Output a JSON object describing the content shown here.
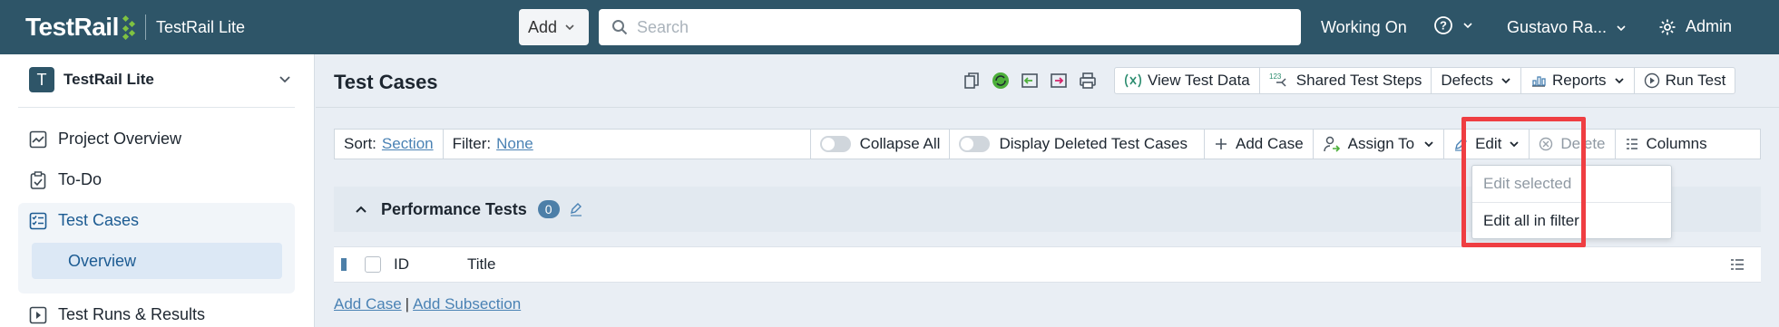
{
  "topbar": {
    "logo_text": "TestRail",
    "app_name": "TestRail Lite",
    "add_label": "Add",
    "search_placeholder": "Search",
    "working_on": "Working On",
    "user_name": "Gustavo Ra...",
    "admin_label": "Admin",
    "bg_color": "#2e5568"
  },
  "sidebar": {
    "project_initial": "T",
    "project_name": "TestRail Lite",
    "items": [
      {
        "label": "Project Overview",
        "icon": "chart-icon"
      },
      {
        "label": "To-Do",
        "icon": "clipboard-check-icon"
      },
      {
        "label": "Test Cases",
        "icon": "test-cases-icon",
        "active": true
      },
      {
        "label": "Test Runs & Results",
        "icon": "play-icon"
      }
    ],
    "subitem": "Overview"
  },
  "main": {
    "title": "Test Cases",
    "toolbar": {
      "view_test_data": "View Test Data",
      "shared_steps_badge": "123",
      "shared_test_steps": "Shared Test Steps",
      "defects": "Defects",
      "reports": "Reports",
      "run_test": "Run Test"
    },
    "filterbar": {
      "sort_label": "Sort:",
      "sort_value": "Section",
      "filter_label": "Filter:",
      "filter_value": "None",
      "collapse_all": "Collapse All",
      "display_deleted": "Display Deleted Test Cases",
      "add_case": "Add Case",
      "assign_to": "Assign To",
      "edit": "Edit",
      "delete": "Delete",
      "columns": "Columns"
    },
    "section": {
      "title": "Performance Tests",
      "count": "0"
    },
    "table": {
      "columns": [
        "ID",
        "Title"
      ]
    },
    "links": {
      "add_case": "Add Case",
      "separator": "|",
      "add_subsection": "Add Subsection"
    },
    "edit_menu": {
      "items": [
        "Edit selected",
        "Edit all in filter"
      ]
    },
    "colors": {
      "accent": "#4a82b4",
      "highlight": "#ef3e42"
    }
  }
}
